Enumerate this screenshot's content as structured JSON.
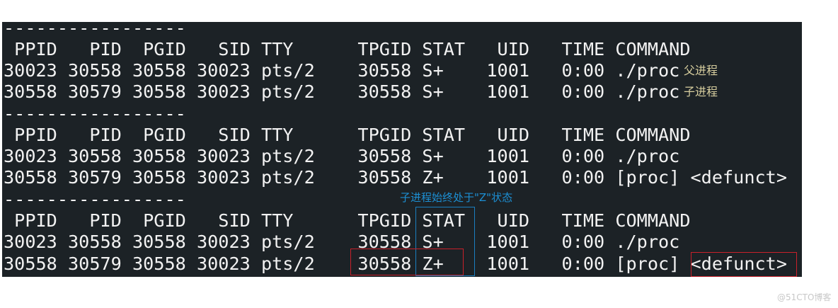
{
  "terminal": {
    "lines": [
      "-----------------",
      " PPID   PID  PGID   SID TTY      TPGID STAT   UID   TIME COMMAND",
      "30023 30558 30558 30023 pts/2    30558 S+    1001   0:00 ./proc",
      "30558 30579 30558 30023 pts/2    30558 S+    1001   0:00 ./proc",
      "-----------------",
      " PPID   PID  PGID   SID TTY      TPGID STAT   UID   TIME COMMAND",
      "30023 30558 30558 30023 pts/2    30558 S+    1001   0:00 ./proc",
      "30558 30579 30558 30023 pts/2    30558 Z+    1001   0:00 [proc] <defunct>",
      "-----------------",
      " PPID   PID  PGID   SID TTY      TPGID STAT   UID   TIME COMMAND",
      "30023 30558 30558 30023 pts/2    30558 S+    1001   0:00 ./proc",
      "30558 30579 30558 30023 pts/2    30558 Z+    1001   0:00 [proc] <defunct>"
    ]
  },
  "annotations": {
    "parent": "父进程",
    "child": "子进程",
    "note": "子进程始终处于\"Z\"状态"
  },
  "watermark": "@51CTO博客",
  "colors": {
    "background": "#1c2226",
    "text": "#f2f2f2",
    "note": "#1c8fd3",
    "highlight_red": "#c8202a",
    "highlight_blue": "#1a7fc0"
  }
}
